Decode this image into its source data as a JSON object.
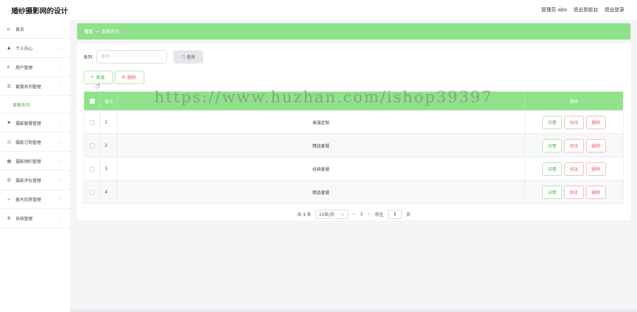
{
  "header": {
    "title": "婚纱摄影网的设计",
    "admin_label": "管理员 abo",
    "exit_front": "退出到前台",
    "logout": "退出登录"
  },
  "sidebar": {
    "items": [
      {
        "icon": "home-icon",
        "glyph": "⌂",
        "label": "首页",
        "chevron": ""
      },
      {
        "icon": "user-icon",
        "glyph": "♟",
        "label": "个人中心",
        "chevron": "⌄"
      },
      {
        "icon": "chart-icon",
        "glyph": "ıl",
        "label": "用户管理",
        "chevron": "⌄"
      },
      {
        "icon": "list-icon",
        "glyph": "☰",
        "label": "套餐系列管理",
        "chevron": "⌃"
      }
    ],
    "sub_item": "套餐系列",
    "items2": [
      {
        "icon": "flag-icon",
        "glyph": "⚑",
        "label": "摄影套餐管理",
        "chevron": "⌄"
      },
      {
        "icon": "clock-icon",
        "glyph": "◷",
        "label": "摄影订购管理",
        "chevron": "⌄"
      },
      {
        "icon": "image-icon",
        "glyph": "▦",
        "label": "摄影预约管理",
        "chevron": "⌄"
      },
      {
        "icon": "list-icon",
        "glyph": "☰",
        "label": "摄影评价管理",
        "chevron": "⌄"
      },
      {
        "icon": "send-icon",
        "glyph": "➶",
        "label": "客片欣赏管理",
        "chevron": "⌄"
      },
      {
        "icon": "settings-icon",
        "glyph": "⚙",
        "label": "系统管理",
        "chevron": "⌄"
      }
    ]
  },
  "breadcrumb": {
    "home": "首页",
    "separator": "→",
    "current": "套餐系列"
  },
  "search": {
    "label": "系列",
    "placeholder": "系列",
    "button": "查询",
    "button_icon": "○"
  },
  "actions": {
    "add": "新增",
    "add_icon": "+",
    "delete": "删除",
    "delete_icon": "⊟"
  },
  "table": {
    "headers": {
      "index": "索引",
      "series": "",
      "ops": "操作"
    },
    "rows": [
      {
        "index": "1",
        "series": "高端定制"
      },
      {
        "index": "2",
        "series": "精选套餐"
      },
      {
        "index": "3",
        "series": "经典套餐"
      },
      {
        "index": "4",
        "series": "精品套餐"
      }
    ],
    "op_labels": {
      "view": "详情",
      "edit": "修改",
      "delete": "删除"
    }
  },
  "pagination": {
    "total": "共 4 条",
    "page_size": "10条/页",
    "prev": "<",
    "current": "1",
    "next": ">",
    "goto_label": "前往",
    "goto_value": "1",
    "page_suffix": "页"
  },
  "watermark": "https://www.huzhan.com/ishop39397",
  "colors": {
    "accent": "#8fe28a",
    "green_text": "#4caf50",
    "danger": "#e55b5b"
  }
}
